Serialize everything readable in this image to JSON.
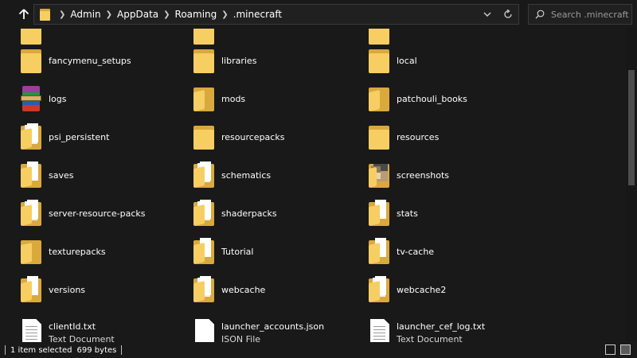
{
  "breadcrumb": {
    "items": [
      "Admin",
      "AppData",
      "Roaming",
      ".minecraft"
    ]
  },
  "search": {
    "placeholder": "Search .minecraft"
  },
  "icons": {
    "up": "up-arrow-icon",
    "address_folder": "folder-icon",
    "dropdown": "chevron-down-icon",
    "refresh": "refresh-icon",
    "search": "search-icon"
  },
  "colors": {
    "folder_front": "#f7ce62",
    "folder_back": "#d9a93e",
    "background": "#191919"
  },
  "files": {
    "row0": [
      {
        "name": "",
        "icon": "folder-icon"
      },
      {
        "name": "",
        "icon": "folder-icon"
      },
      {
        "name": "",
        "icon": "folder-icon"
      }
    ],
    "row1": [
      {
        "name": "fancymenu_setups",
        "icon": "folder-icon"
      },
      {
        "name": "libraries",
        "icon": "folder-icon"
      },
      {
        "name": "local",
        "icon": "folder-icon"
      }
    ],
    "row2": [
      {
        "name": "logs",
        "icon": "winrar-archive-icon"
      },
      {
        "name": "mods",
        "icon": "folder-icon"
      },
      {
        "name": "patchouli_books",
        "icon": "folder-icon"
      }
    ],
    "row3": [
      {
        "name": "psi_persistent",
        "icon": "folder-icon"
      },
      {
        "name": "resourcepacks",
        "icon": "folder-icon"
      },
      {
        "name": "resources",
        "icon": "folder-icon"
      }
    ],
    "row4": [
      {
        "name": "saves",
        "icon": "folder-icon"
      },
      {
        "name": "schematics",
        "icon": "folder-icon"
      },
      {
        "name": "screenshots",
        "icon": "folder-with-images-icon"
      }
    ],
    "row5": [
      {
        "name": "server-resource-packs",
        "icon": "folder-icon"
      },
      {
        "name": "shaderpacks",
        "icon": "folder-icon"
      },
      {
        "name": "stats",
        "icon": "folder-icon"
      }
    ],
    "row6": [
      {
        "name": "texturepacks",
        "icon": "folder-icon"
      },
      {
        "name": "Tutorial",
        "icon": "folder-icon"
      },
      {
        "name": "tv-cache",
        "icon": "folder-icon"
      }
    ],
    "row7": [
      {
        "name": "versions",
        "icon": "folder-icon"
      },
      {
        "name": "webcache",
        "icon": "folder-icon"
      },
      {
        "name": "webcache2",
        "icon": "folder-icon"
      }
    ],
    "row8": [
      {
        "name": "clientId.txt",
        "type": "Text Document",
        "icon": "text-document-icon"
      },
      {
        "name": "launcher_accounts.json",
        "type": "JSON File",
        "icon": "json-file-icon"
      },
      {
        "name": "launcher_cef_log.txt",
        "type": "Text Document",
        "icon": "text-document-icon"
      }
    ]
  },
  "status": {
    "selection": "1 item selected",
    "size": "699 bytes"
  }
}
